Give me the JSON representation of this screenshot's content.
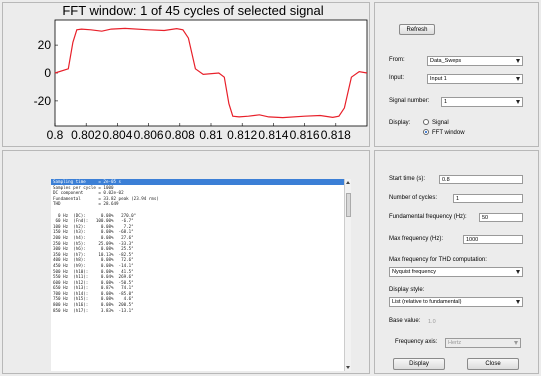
{
  "plot": {
    "title": "FFT window: 1 of 45 cycles of selected signal",
    "y_ticks": [
      "20",
      "0",
      "-20"
    ],
    "x_ticks": [
      "0.8",
      "0.802",
      "0.804",
      "0.806",
      "0.808",
      "0.81",
      "0.812",
      "0.814",
      "0.816",
      "0.818"
    ],
    "line_color": "#e8202a"
  },
  "controls": {
    "refresh_label": "Refresh",
    "from_label": "From:",
    "from_value": "Data_Sweps",
    "input_label": "Input:",
    "input_value": "Input 1",
    "signal_label": "Signal number:",
    "signal_value": "1",
    "display_label": "Display:",
    "display_opt1": "Signal",
    "display_opt2": "FFT window"
  },
  "listing": {
    "rows": [
      "Sampling time     = 2e-05 s",
      "Samples per cycle = 1000",
      "DC component      = 0.02e-02",
      "Fundamental       = 33.82 peak (23.94 rms)",
      "THD               = 28.649",
      "",
      "  0 Hz  (DC):      0.08%   270.0°",
      " 60 Hz  (Fnd):   100.00%   -6.7°",
      "100 Hz  (h2):      0.08%    7.2°",
      "150 Hz  (h3):      0.08%  -68.1°",
      "200 Hz  (h4):      0.08%   27.6°",
      "250 Hz  (h5):     25.09%  -33.3°",
      "300 Hz  (h6):      0.08%   25.5°",
      "350 Hz  (h7):     10.13%  -82.5°",
      "400 Hz  (h8):      0.08%   72.6°",
      "450 Hz  (h9):      0.08%  -14.1°",
      "500 Hz  (h10):     0.08%   41.5°",
      "550 Hz  (h11):     0.04%  269.6°",
      "600 Hz  (h12):     0.08%  -50.5°",
      "650 Hz  (h13):     0.87%   74.1°",
      "700 Hz  (h14):     0.08%  -85.0°",
      "750 Hz  (h15):     0.08%    4.6°",
      "800 Hz  (h16):     0.08%  200.5°",
      "850 Hz  (h17):     3.83%  -13.1°"
    ]
  },
  "settings": {
    "start_time_label": "Start time (s):",
    "start_time_value": "0.8",
    "cycles_label": "Number of cycles:",
    "cycles_value": "1",
    "fund_freq_label": "Fundamental frequency (Hz):",
    "fund_freq_value": "50",
    "max_freq_label": "Max frequency (Hz):",
    "max_freq_value": "1000",
    "thd_freq_label": "Max frequency for THD computation:",
    "thd_freq_value": "Nyquist frequency",
    "display_style_label": "Display style:",
    "display_style_value": "List (relative to fundamental)",
    "base_value_label": "Base value:",
    "base_value_value": "1.0",
    "freq_axis_label": "Frequency axis:",
    "freq_axis_value": "Hertz",
    "display_button": "Display",
    "close_button": "Close"
  }
}
